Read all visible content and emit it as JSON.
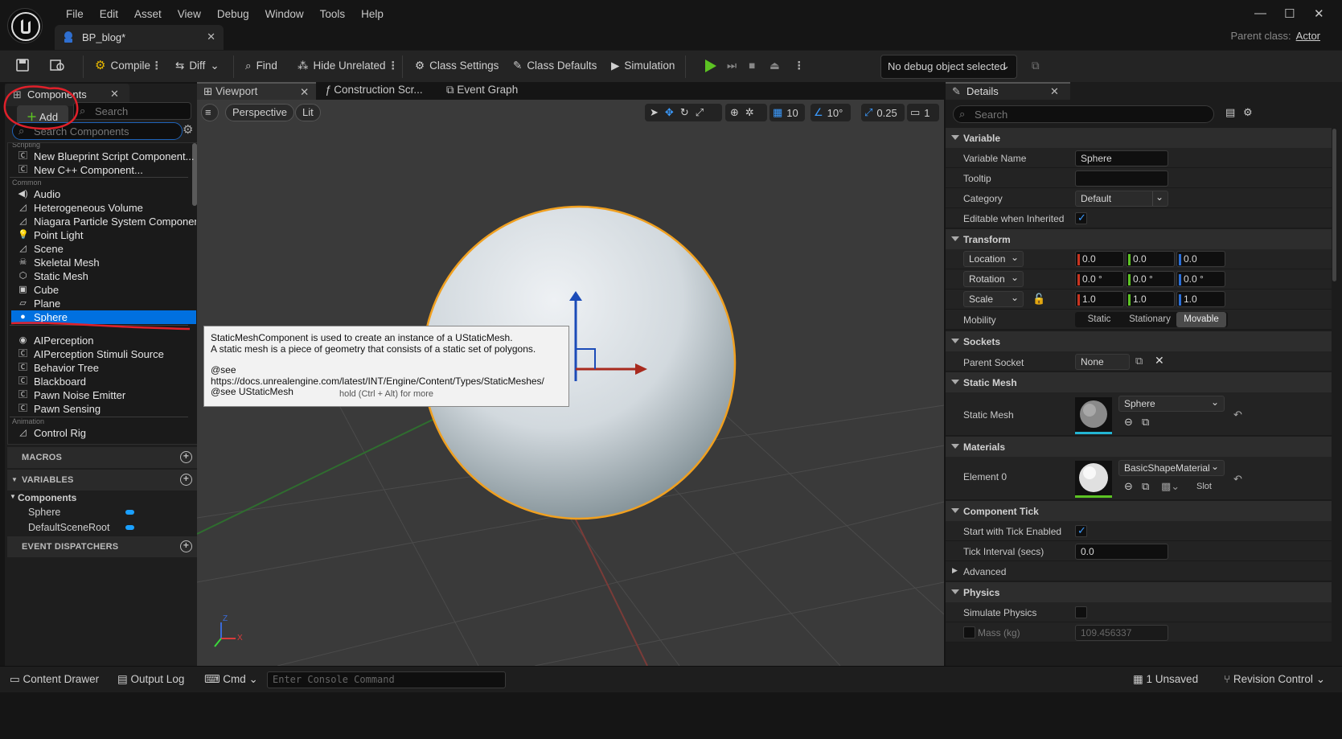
{
  "menu": [
    "File",
    "Edit",
    "Asset",
    "View",
    "Debug",
    "Window",
    "Tools",
    "Help"
  ],
  "document_tab": "BP_blog*",
  "parent_class": {
    "label": "Parent class:",
    "value": "Actor"
  },
  "toolbar": {
    "compile": "Compile",
    "diff": "Diff",
    "find": "Find",
    "hide_unrelated": "Hide Unrelated",
    "class_settings": "Class Settings",
    "class_defaults": "Class Defaults",
    "simulation": "Simulation",
    "debug_object": "No debug object selected"
  },
  "components_panel": {
    "tab": "Components",
    "add": "Add",
    "search_placeholder": "Search",
    "search_components_placeholder": "Search Components",
    "categories": {
      "scripting": "Scripting",
      "common": "Common",
      "ai": "AI",
      "animation": "Animation"
    },
    "scripting_items": [
      "New Blueprint Script Component...",
      "New C++ Component..."
    ],
    "common_items": [
      "Audio",
      "Heterogeneous Volume",
      "Niagara Particle System Component",
      "Point Light",
      "Scene",
      "Skeletal Mesh",
      "Static Mesh",
      "Cube",
      "Plane",
      "Sphere"
    ],
    "ai_items": [
      "AIPerception",
      "AIPerception Stimuli Source",
      "Behavior Tree",
      "Blackboard",
      "Pawn Noise Emitter",
      "Pawn Sensing"
    ],
    "animation_items": [
      "Control Rig"
    ]
  },
  "my_blueprint": {
    "macros": "MACROS",
    "variables": "VARIABLES",
    "components_group": "Components",
    "component_vars": [
      "Sphere",
      "DefaultSceneRoot"
    ],
    "event_dispatchers": "EVENT DISPATCHERS"
  },
  "editor_tabs": [
    "Viewport",
    "Construction Scr...",
    "Event Graph"
  ],
  "viewport": {
    "perspective": "Perspective",
    "lit": "Lit",
    "grid_snap": "10",
    "rot_snap": "10°",
    "scale_snap": "0.25",
    "camera_speed": "1",
    "axis_z": "Z",
    "axis_x": "X"
  },
  "tooltip": {
    "line1": "StaticMeshComponent is used to create an instance of a UStaticMesh.",
    "line2": "A static mesh is a piece of geometry that consists of a static set of polygons.",
    "line3": "@see https://docs.unrealengine.com/latest/INT/Engine/Content/Types/StaticMeshes/",
    "line4": "@see UStaticMesh",
    "more": "hold (Ctrl + Alt) for more"
  },
  "details": {
    "tab": "Details",
    "search_placeholder": "Search",
    "variable": {
      "header": "Variable",
      "name_label": "Variable Name",
      "name_value": "Sphere",
      "tooltip_label": "Tooltip",
      "category_label": "Category",
      "category_value": "Default",
      "editable_label": "Editable when Inherited"
    },
    "transform": {
      "header": "Transform",
      "location": "Location",
      "rotation": "Rotation",
      "scale": "Scale",
      "location_values": [
        "0.0",
        "0.0",
        "0.0"
      ],
      "rotation_values": [
        "0.0 °",
        "0.0 °",
        "0.0 °"
      ],
      "scale_values": [
        "1.0",
        "1.0",
        "1.0"
      ],
      "mobility_label": "Mobility",
      "mobility_options": [
        "Static",
        "Stationary",
        "Movable"
      ],
      "mobility_selected": "Movable"
    },
    "sockets": {
      "header": "Sockets",
      "parent_socket_label": "Parent Socket",
      "parent_socket_value": "None"
    },
    "static_mesh": {
      "header": "Static Mesh",
      "label": "Static Mesh",
      "value": "Sphere"
    },
    "materials": {
      "header": "Materials",
      "element_label": "Element 0",
      "value": "BasicShapeMaterial",
      "slot": "Slot"
    },
    "component_tick": {
      "header": "Component Tick",
      "start_label": "Start with Tick Enabled",
      "interval_label": "Tick Interval (secs)",
      "interval_value": "0.0",
      "advanced": "Advanced"
    },
    "physics": {
      "header": "Physics",
      "simulate_label": "Simulate Physics",
      "mass_label": "Mass (kg)",
      "mass_value": "109.456337"
    }
  },
  "bottom_bar": {
    "content_drawer": "Content Drawer",
    "output_log": "Output Log",
    "cmd": "Cmd",
    "console_placeholder": "Enter Console Command",
    "unsaved": "1 Unsaved",
    "revision_control": "Revision Control"
  },
  "colors": {
    "accent": "#0070e0",
    "annotation": "#e0202a",
    "play": "#5cc323",
    "selection_outline": "#f0a020"
  }
}
